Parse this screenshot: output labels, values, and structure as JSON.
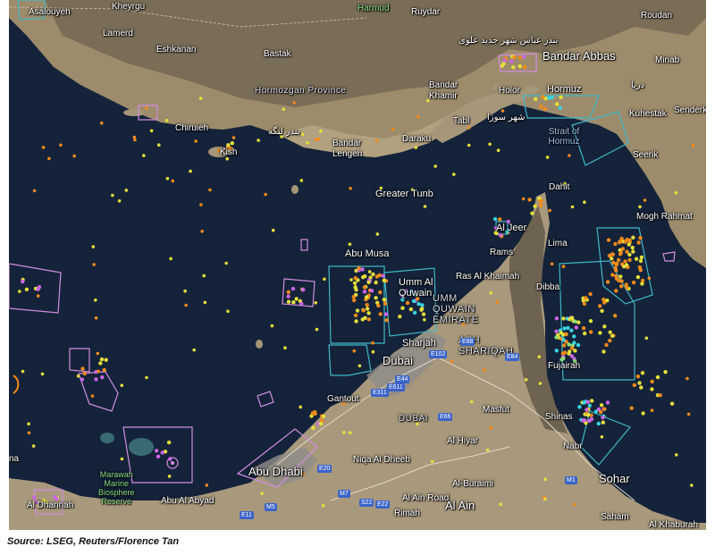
{
  "caption": "Source: LSEG, Reuters/Florence Tan",
  "map_labels": {
    "asalouyeh": "Asalouyeh",
    "kheyrgu": "Kheyrgu",
    "harmud": "Harmud",
    "ruydar": "Ruydar",
    "roudan": "Roudan",
    "lamerd": "Lamerd",
    "eshkanan": "Eshkanan",
    "bastak": "Bastak",
    "farsi_bandar_abbas": "بندر عباس شهر جدید علوی",
    "bandar_abbas": "Bandar Abbas",
    "minab": "Minab",
    "hormozgan": "Hormozgan Province",
    "bandar_khamir": "Bandar\nKhamir",
    "holor": "Holor",
    "hormuz": "Hormuz",
    "farsi_hormuz": "دریا",
    "kuhestak": "Kuhestak",
    "senderk": "Senderk",
    "tabl": "Tabl",
    "farsi_tabl": "شهر سوزا",
    "chiruieh": "Chiruieh",
    "farsi_lengeh": "بندر لنگه",
    "bandar_lengeh": "Bandar\nLengeh",
    "daraku": "Daraku",
    "strait_of_hormuz": "Strait of\nHormuz",
    "kish": "Kish",
    "seerik": "Seerik",
    "dahit": "Dahit",
    "greater_tunb": "Greater Tunb",
    "mogh_rahmat": "Mogh Rahmat",
    "al_jeer": "Al Jeer",
    "lima": "Lima",
    "abu_musa": "Abu Musa",
    "rams": "Rams",
    "ras_al_khaimah": "Ras Al Khaimah",
    "dibba": "Dibba",
    "umm_al_quwain": "Umm Al\nQuwain",
    "umm_quwain_emirate": "UMM\nQUWAIN\nEMIRATE",
    "sharjah": "Sharjah",
    "ash_shariqah": "ASH\nSHARIQAH",
    "fujairah": "Fujairah",
    "dubai": "Dubai",
    "gantout": "Gantout",
    "dubai_region": "DUBAI",
    "masfut": "Masfut",
    "shinas": "Shinas",
    "al_hiyar": "Al Hiyar",
    "nabr": "Nabr",
    "abu_dhabi": "Abu Dhabi",
    "niqa_al_dheeb": "Niqa Al Dheeb",
    "sohar": "Sohar",
    "marawah": "Marawah\nMarine\nBiosphere\nReserve",
    "abu_al_abyad": "Abu Al Abyad",
    "al_ain_road": "Al Ain Road",
    "al_buraimi": "Al-Buraimi",
    "al_ain": "Al Ain",
    "rimah": "Rimah",
    "saham": "Saham",
    "al_khaburah": "Al Khaburah",
    "al_dhannah": "Al Dhannah",
    "left_edge": "na"
  },
  "road_shields": [
    "E44",
    "E311",
    "E611",
    "E102",
    "E88",
    "E84",
    "E66",
    "M5",
    "E11",
    "E22",
    "E20",
    "M1",
    "M7",
    "S22"
  ],
  "colors": {
    "sea": "#14233a",
    "land": "#a9997c",
    "mountain": "#6f6350",
    "urban": "#8d8a87",
    "zone_outline_cyan": "#3fb7c6",
    "zone_outline_pink": "#d28de0",
    "vessel_orange": "#f08a1c",
    "vessel_yellow": "#e4e03a",
    "vessel_pink": "#cc66e6",
    "vessel_cyan": "#38d4e0",
    "vessel_green": "#8de07a"
  }
}
